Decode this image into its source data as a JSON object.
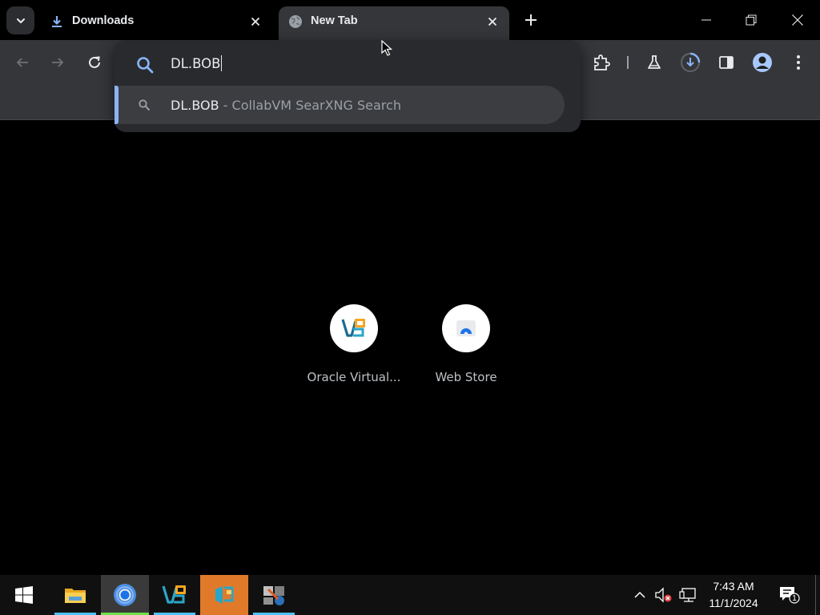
{
  "tabs": [
    {
      "title": "Downloads",
      "state": "inactive",
      "icon": "download-icon"
    },
    {
      "title": "New Tab",
      "state": "active",
      "icon": "globe-icon"
    }
  ],
  "omnibox": {
    "input_value": "DL.BOB",
    "suggestion": {
      "query": "DL.BOB",
      "separator": " - ",
      "engine": "CollabVM SearXNG Search"
    }
  },
  "shortcuts": [
    {
      "label": "Oracle Virtual...",
      "icon": "virtualbox-icon"
    },
    {
      "label": "Web Store",
      "icon": "web-store-icon"
    }
  ],
  "toolbar": {
    "icons": [
      "back-icon",
      "forward-icon",
      "reload-icon",
      "extensions-icon",
      "labs-flask-icon",
      "download-progress-icon",
      "side-panel-icon",
      "profile-icon",
      "menu-icon"
    ]
  },
  "taskbar": {
    "apps": [
      "file-explorer-icon",
      "chrome-icon",
      "virtualbox-icon",
      "vm-tool-icon",
      "app-icon"
    ],
    "time": "7:43 AM",
    "date": "11/1/2024",
    "notification_count": "1"
  },
  "colors": {
    "accent": "#8ab4f8",
    "tab_active_bg": "#35363a",
    "popup_bg": "#292a2d",
    "suggestion_bg": "#3c3d41",
    "taskbar_bg": "#101010"
  }
}
